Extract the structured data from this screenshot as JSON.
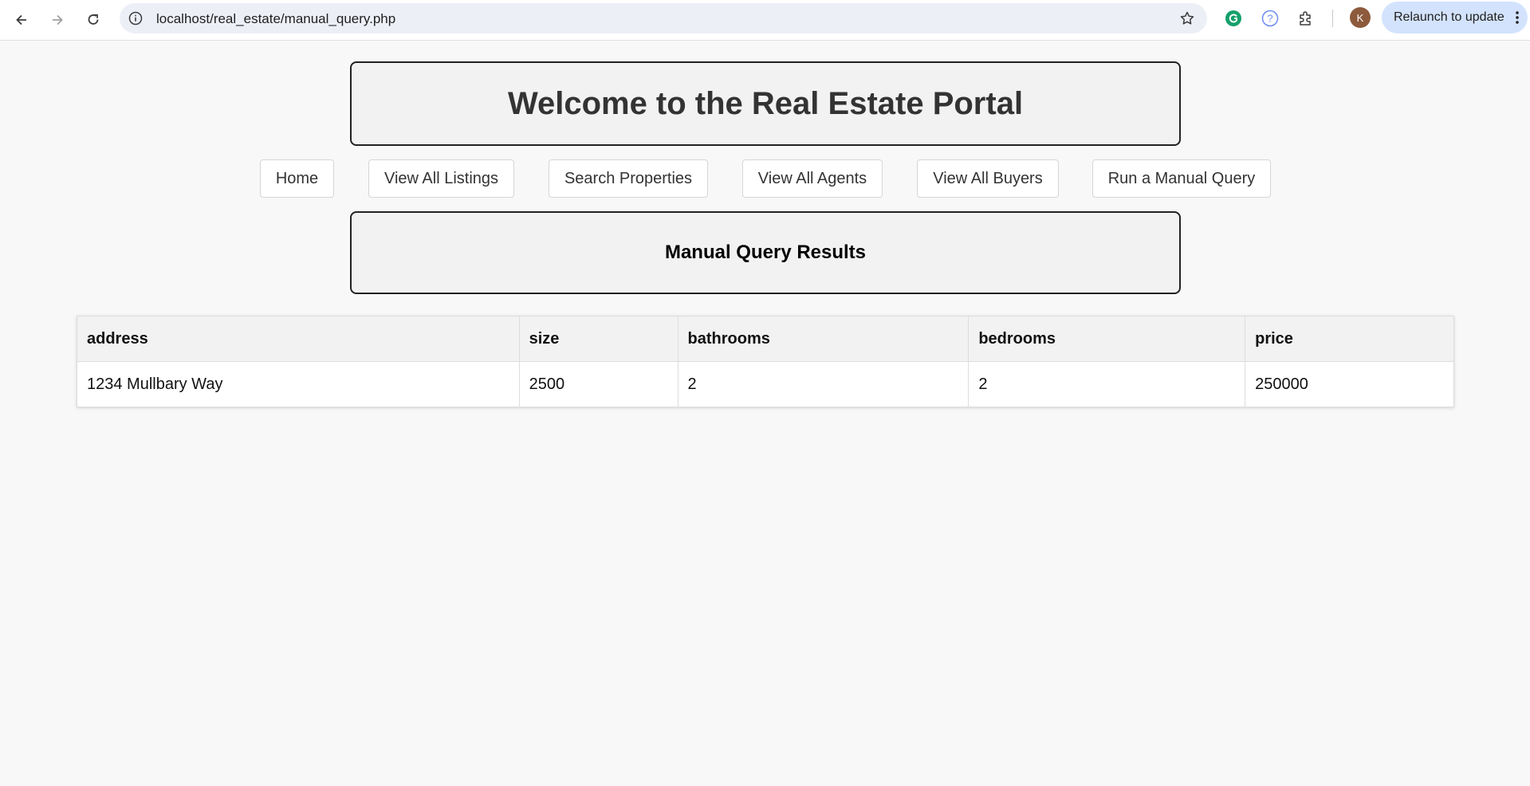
{
  "browser": {
    "url": "localhost/real_estate/manual_query.php",
    "avatar_initial": "K",
    "relaunch_label": "Relaunch to update"
  },
  "page": {
    "title": "Welcome to the Real Estate Portal",
    "results_heading": "Manual Query Results"
  },
  "nav": [
    {
      "label": "Home"
    },
    {
      "label": "View All Listings"
    },
    {
      "label": "Search Properties"
    },
    {
      "label": "View All Agents"
    },
    {
      "label": "View All Buyers"
    },
    {
      "label": "Run a Manual Query"
    }
  ],
  "table": {
    "columns": [
      "address",
      "size",
      "bathrooms",
      "bedrooms",
      "price"
    ],
    "rows": [
      [
        "1234 Mullbary Way",
        "2500",
        "2",
        "2",
        "250000"
      ]
    ]
  },
  "colors": {
    "page_background": "#f8f8f8",
    "heading_border": "#222222",
    "relaunch_background": "#d3e3fd"
  }
}
